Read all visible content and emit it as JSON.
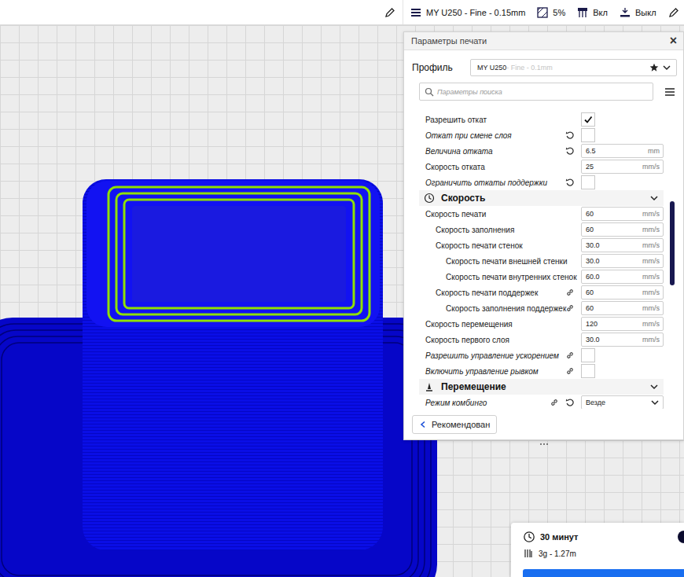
{
  "top_bar": {
    "profile": "MY U250 - Fine - 0.15mm",
    "infill": "5%",
    "support": "Вкл",
    "adhesion": "Выкл"
  },
  "panel": {
    "title": "Параметры печати",
    "close": "×",
    "profile_label": "Профиль",
    "profile_value": "MY U250",
    "profile_suffix": " - Fine - 0.1mm",
    "search_placeholder": "Параметры поиска"
  },
  "scrollbar": {
    "level": 0.28,
    "offset": 0.31
  },
  "settings": [
    {
      "kind": "checkbox",
      "label": "Разрешить откат",
      "depth": 0,
      "modified": false,
      "reset": false,
      "linked": false,
      "checked": true
    },
    {
      "kind": "checkbox",
      "label": "Откат при смене слоя",
      "depth": 0,
      "modified": true,
      "reset": true,
      "linked": false,
      "checked": false
    },
    {
      "kind": "field",
      "label": "Величина отката",
      "depth": 0,
      "modified": true,
      "reset": true,
      "linked": false,
      "value": "6.5",
      "unit": "mm"
    },
    {
      "kind": "field",
      "label": "Скорость отката",
      "depth": 0,
      "modified": false,
      "reset": false,
      "linked": false,
      "value": "25",
      "unit": "mm/s"
    },
    {
      "kind": "checkbox",
      "label": "Ограничить откаты поддержки",
      "depth": 0,
      "modified": true,
      "reset": true,
      "linked": false,
      "checked": false
    },
    {
      "kind": "section",
      "label": "Скорость",
      "depth": 0,
      "expanded": true
    },
    {
      "kind": "field",
      "label": "Скорость печати",
      "depth": 0,
      "modified": false,
      "reset": false,
      "linked": false,
      "value": "60",
      "unit": "mm/s"
    },
    {
      "kind": "field",
      "label": "Скорость заполнения",
      "depth": 1,
      "modified": false,
      "reset": false,
      "linked": false,
      "value": "60",
      "unit": "mm/s"
    },
    {
      "kind": "field",
      "label": "Скорость печати стенок",
      "depth": 1,
      "modified": false,
      "reset": false,
      "linked": false,
      "value": "30.0",
      "unit": "mm/s"
    },
    {
      "kind": "field",
      "label": "Скорость печати внешней стенки",
      "depth": 2,
      "modified": false,
      "reset": false,
      "linked": false,
      "value": "30.0",
      "unit": "mm/s"
    },
    {
      "kind": "field",
      "label": "Скорость печати внутренних стенок",
      "depth": 2,
      "modified": false,
      "reset": false,
      "linked": false,
      "value": "60.0",
      "unit": "mm/s"
    },
    {
      "kind": "field",
      "label": "Скорость печати поддержек",
      "depth": 1,
      "modified": false,
      "reset": false,
      "linked": true,
      "value": "60",
      "unit": "mm/s"
    },
    {
      "kind": "field",
      "label": "Скорость заполнения поддержек",
      "depth": 2,
      "modified": false,
      "reset": false,
      "linked": true,
      "value": "60",
      "unit": "mm/s"
    },
    {
      "kind": "field",
      "label": "Скорость перемещения",
      "depth": 0,
      "modified": false,
      "reset": false,
      "linked": false,
      "value": "120",
      "unit": "mm/s"
    },
    {
      "kind": "field",
      "label": "Скорость первого слоя",
      "depth": 0,
      "modified": false,
      "reset": false,
      "linked": false,
      "value": "30.0",
      "unit": "mm/s"
    },
    {
      "kind": "checkbox",
      "label": "Разрешить управление ускорением",
      "depth": 0,
      "modified": true,
      "reset": false,
      "linked": true,
      "checked": false
    },
    {
      "kind": "checkbox",
      "label": "Включить управление рывком",
      "depth": 0,
      "modified": true,
      "reset": false,
      "linked": true,
      "checked": false
    },
    {
      "kind": "section",
      "label": "Перемещение",
      "depth": 0,
      "expanded": true
    },
    {
      "kind": "dropdown",
      "label": "Режим комбинго",
      "depth": 0,
      "modified": true,
      "reset": true,
      "linked": true,
      "value": "Везде"
    }
  ],
  "footer": {
    "button": "Рекомендован"
  },
  "estimate": {
    "time": "30 минут",
    "material": "3g - 1.27m"
  }
}
